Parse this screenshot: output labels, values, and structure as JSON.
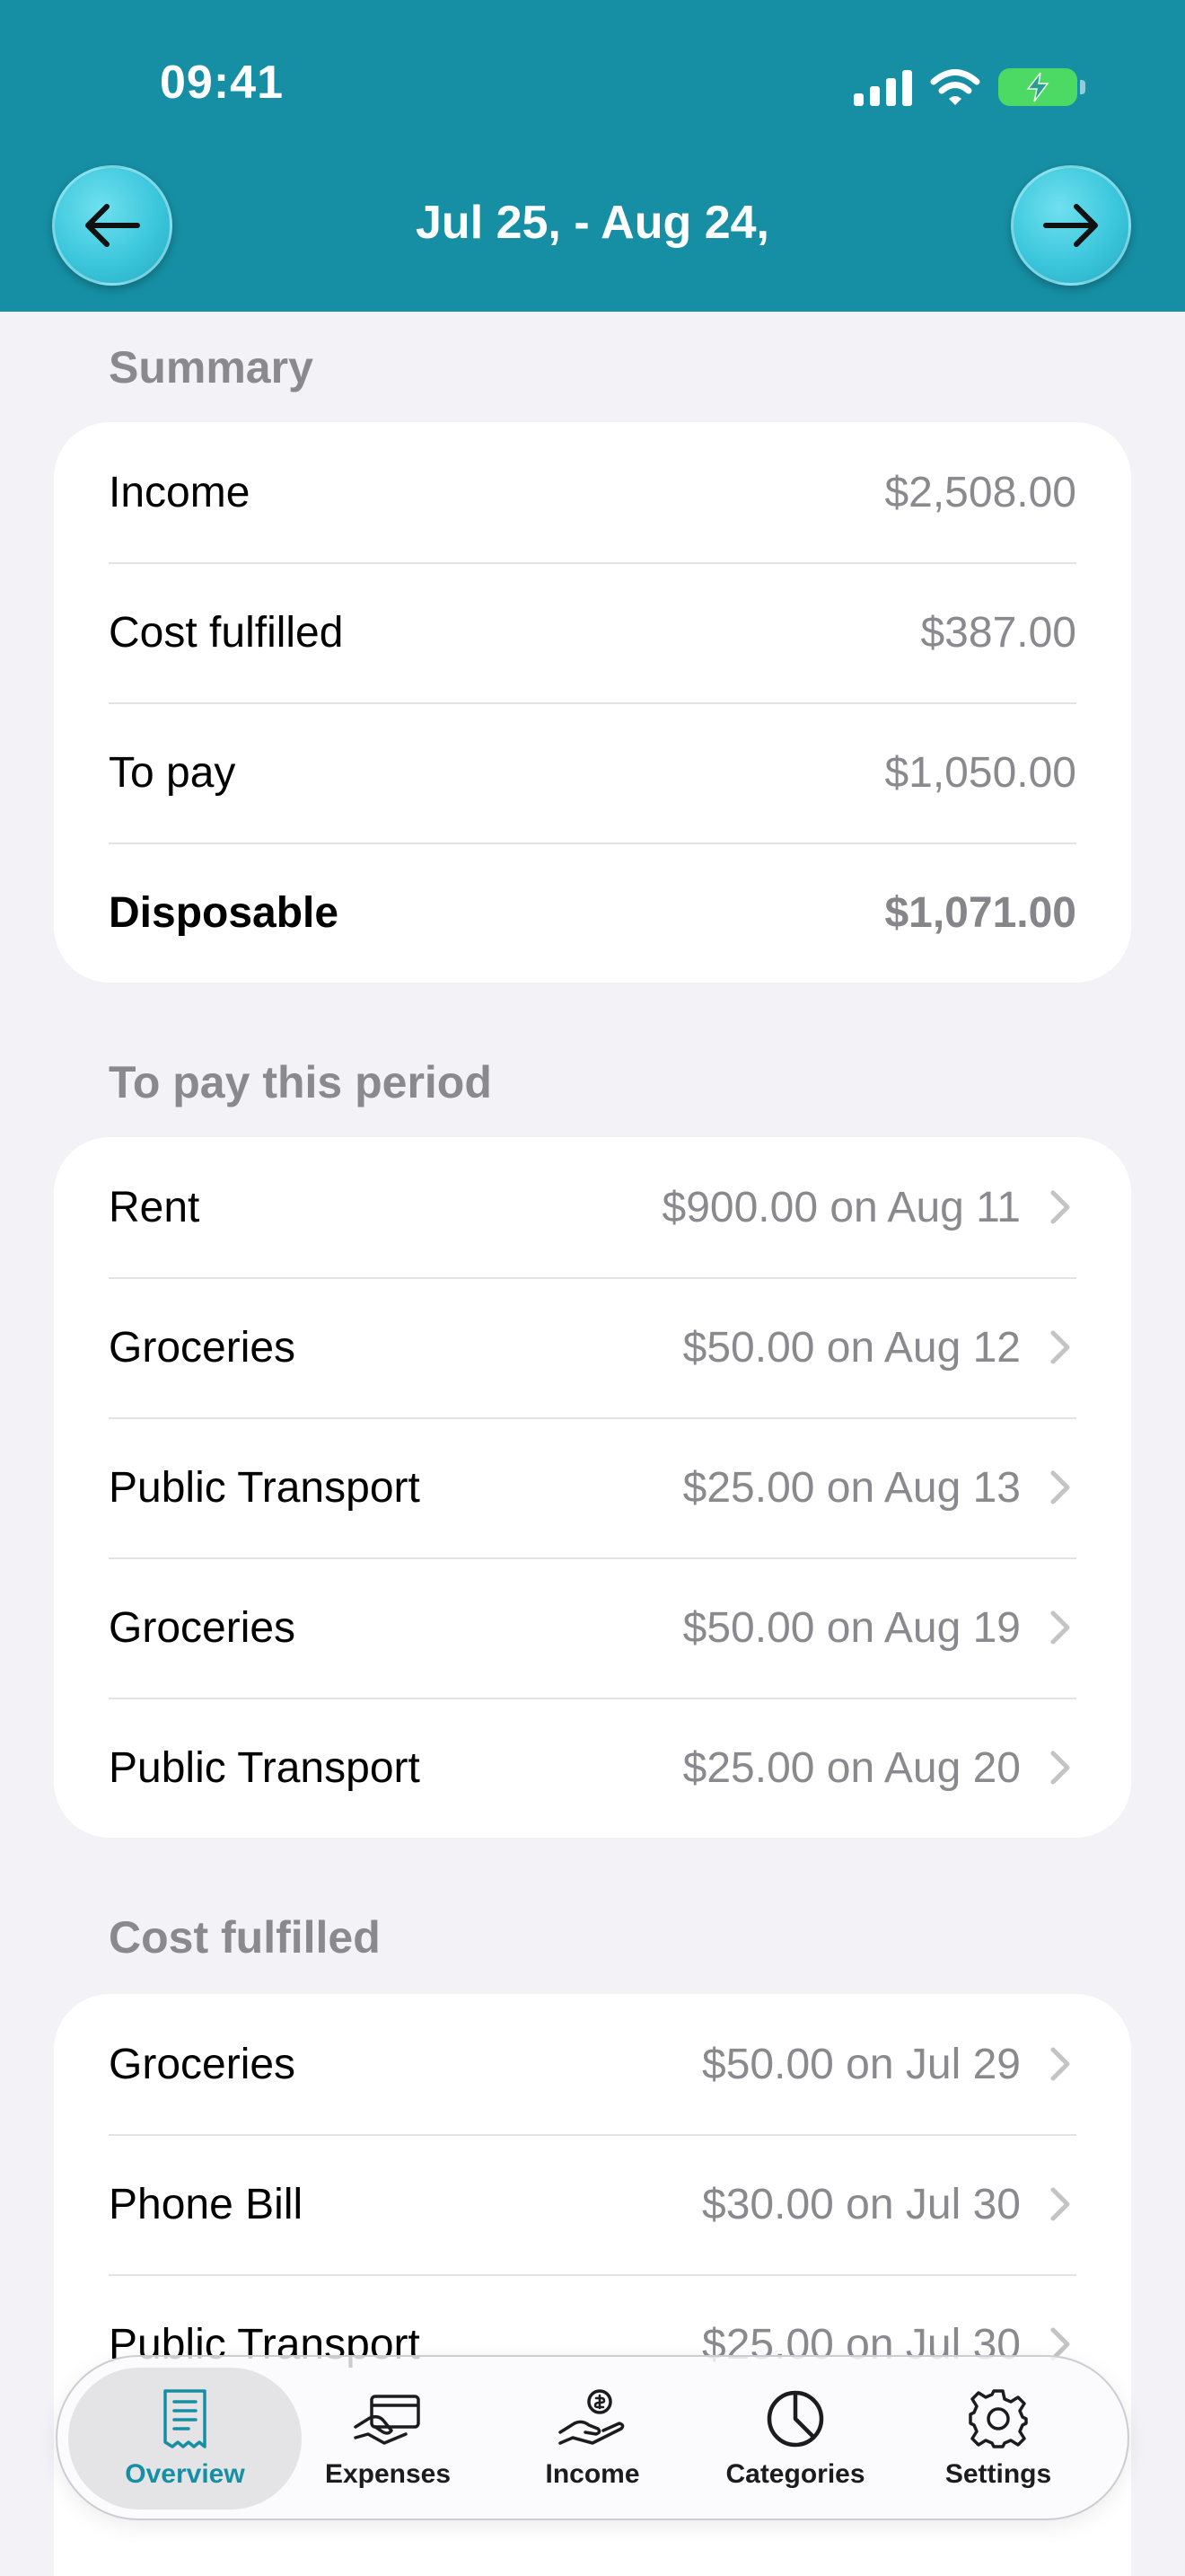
{
  "status_bar": {
    "time": "09:41"
  },
  "header": {
    "period": "Jul 25, - Aug 24,"
  },
  "summary": {
    "title": "Summary",
    "rows": [
      {
        "label": "Income",
        "value": "$2,508.00"
      },
      {
        "label": "Cost fulfilled",
        "value": "$387.00"
      },
      {
        "label": "To pay",
        "value": "$1,050.00"
      },
      {
        "label": "Disposable",
        "value": "$1,071.00"
      }
    ]
  },
  "to_pay": {
    "title": "To pay this period",
    "rows": [
      {
        "label": "Rent",
        "value": "$900.00 on Aug 11"
      },
      {
        "label": "Groceries",
        "value": "$50.00 on Aug 12"
      },
      {
        "label": "Public Transport",
        "value": "$25.00 on Aug 13"
      },
      {
        "label": "Groceries",
        "value": "$50.00 on Aug 19"
      },
      {
        "label": "Public Transport",
        "value": "$25.00 on Aug 20"
      }
    ]
  },
  "cost_fulfilled": {
    "title": "Cost fulfilled",
    "rows": [
      {
        "label": "Groceries",
        "value": "$50.00 on Jul 29"
      },
      {
        "label": "Phone Bill",
        "value": "$30.00 on Jul 30"
      },
      {
        "label": "Public Transport",
        "value": "$25.00 on Jul 30"
      }
    ]
  },
  "tabbar": {
    "active": "Overview",
    "tabs": [
      {
        "label": "Overview",
        "icon": "receipt-icon"
      },
      {
        "label": "Expenses",
        "icon": "card-hand-icon"
      },
      {
        "label": "Income",
        "icon": "money-hand-icon"
      },
      {
        "label": "Categories",
        "icon": "pie-chart-icon"
      },
      {
        "label": "Settings",
        "icon": "gear-icon"
      }
    ]
  },
  "colors": {
    "header": "#168fa4",
    "nav_button": "#3cc7dc",
    "background": "#f2f2f7",
    "secondary_text": "#8a8a8e",
    "battery": "#4cd964"
  }
}
